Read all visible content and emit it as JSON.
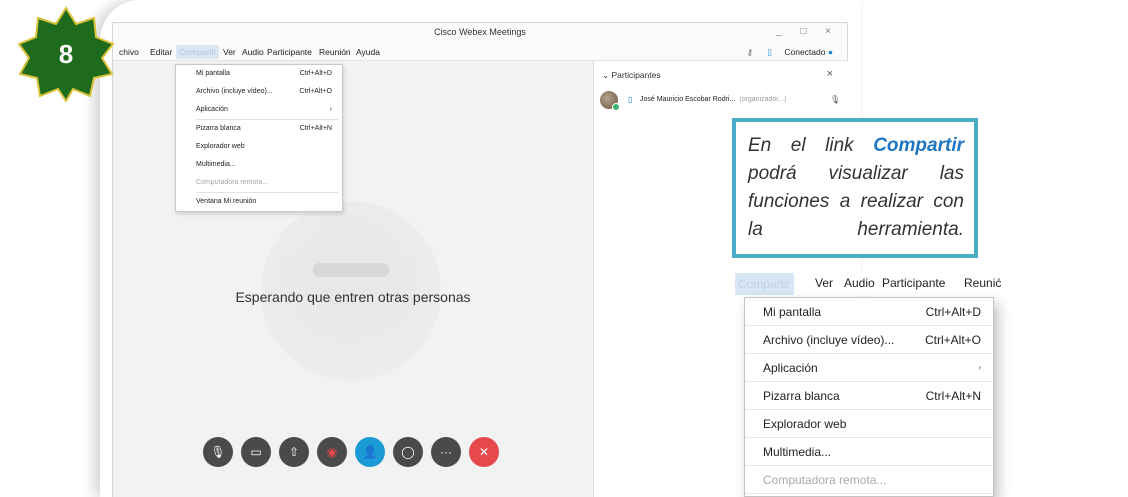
{
  "step_badge": {
    "number": "8",
    "color": "#1e6b1e"
  },
  "window": {
    "title": "Cisco Webex Meetings",
    "controls": "_ □ ×",
    "status_label": "Conectado",
    "status_color": "#1b86d6"
  },
  "menubar": {
    "items": [
      "chivo",
      "Editar",
      "Compartir",
      "Ver",
      "Audio",
      "Participante",
      "Reunión",
      "Ayuda"
    ],
    "active": "Compartir"
  },
  "share_menu": {
    "items": [
      {
        "label": "Mi pantalla",
        "shortcut": "Ctrl+Alt+D",
        "enabled": true
      },
      {
        "label": "Archivo (incluye vídeo)...",
        "shortcut": "Ctrl+Alt+O",
        "enabled": true
      },
      {
        "label": "Aplicación",
        "shortcut": "",
        "submenu": true,
        "enabled": true
      },
      {
        "label": "Pizarra blanca",
        "shortcut": "Ctrl+Alt+N",
        "enabled": true
      },
      {
        "label": "Explorador web",
        "shortcut": "",
        "enabled": true
      },
      {
        "label": "Multimedia...",
        "shortcut": "",
        "enabled": true
      },
      {
        "label": "Computadora remota...",
        "shortcut": "",
        "enabled": false
      },
      {
        "label": "Ventana Mi reunión",
        "shortcut": "",
        "enabled": true
      }
    ]
  },
  "stage": {
    "waiting_text": "Esperando que entren otras personas"
  },
  "controls": [
    "mute-icon",
    "video-icon",
    "share-icon",
    "record-icon",
    "participants-icon",
    "chat-icon",
    "more-icon",
    "end-icon"
  ],
  "participants": {
    "title": "Participantes",
    "list": [
      {
        "name": "José Mauricio Escobar Rodri...",
        "role": "(organizador...)"
      }
    ]
  },
  "callout": {
    "prefix": "En el link",
    "highlight": "Compartir",
    "suffix": "podrá visualizar las funciones a realizar con la herramienta."
  },
  "zoom_menubar": {
    "items": [
      "Compartir",
      "Ver",
      "Audio",
      "Participante",
      "Reunić"
    ]
  },
  "zoom_menu": {
    "items": [
      {
        "label": "Mi pantalla",
        "shortcut": "Ctrl+Alt+D",
        "enabled": true
      },
      {
        "label": "Archivo (incluye vídeo)...",
        "shortcut": "Ctrl+Alt+O",
        "enabled": true
      },
      {
        "label": "Aplicación",
        "shortcut": "",
        "submenu": true,
        "enabled": true
      },
      {
        "label": "Pizarra blanca",
        "shortcut": "Ctrl+Alt+N",
        "enabled": true
      },
      {
        "label": "Explorador web",
        "shortcut": "",
        "enabled": true
      },
      {
        "label": "Multimedia...",
        "shortcut": "",
        "enabled": true
      },
      {
        "label": "Computadora remota...",
        "shortcut": "",
        "enabled": false
      }
    ]
  }
}
